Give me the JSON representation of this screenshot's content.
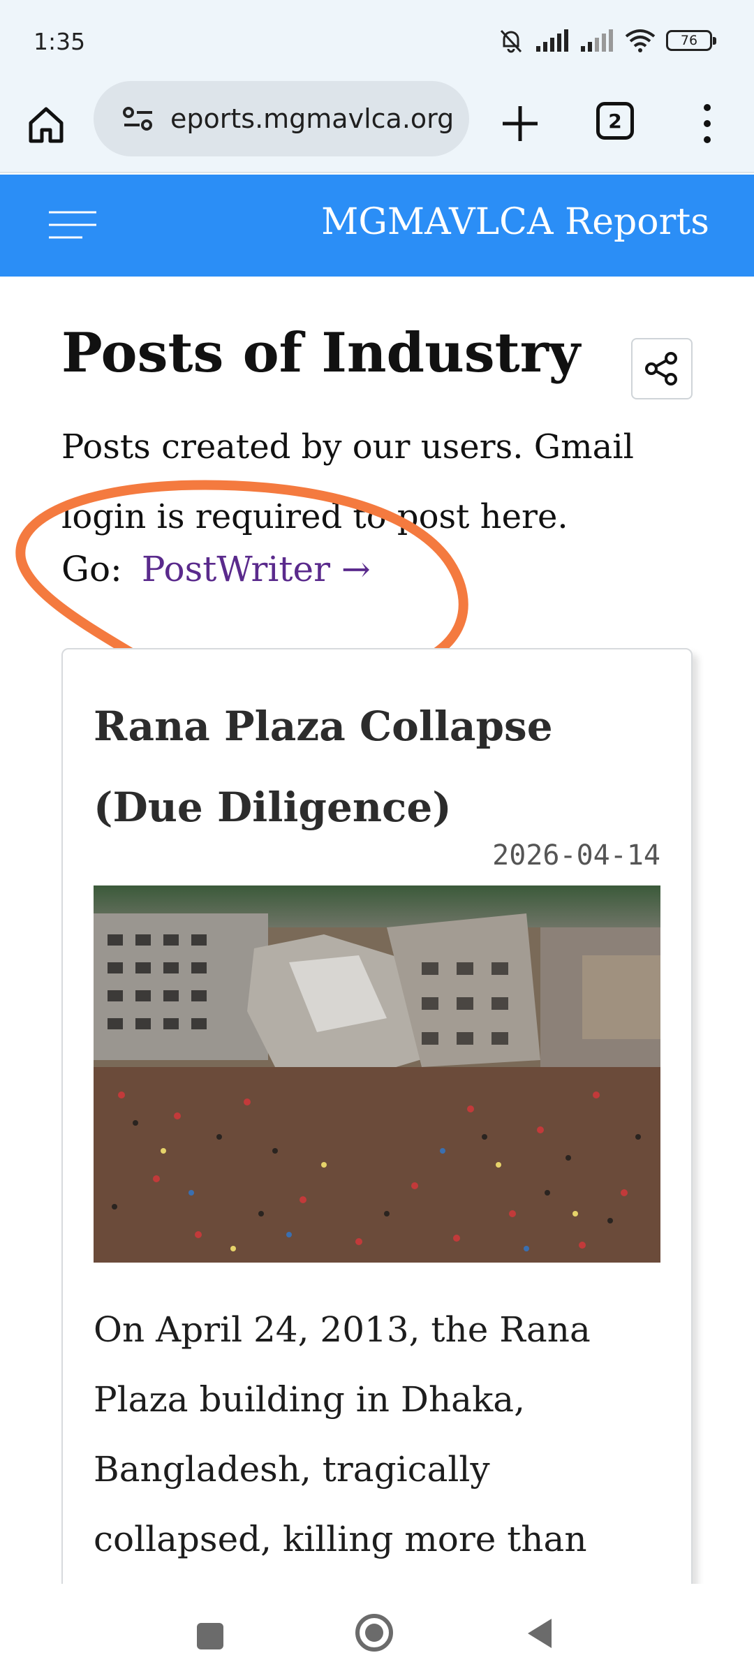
{
  "status_bar": {
    "time": "1:35",
    "battery": "76"
  },
  "browser": {
    "url": "eports.mgmavlca.org",
    "tab_count": "2"
  },
  "site": {
    "title": "MGMAVLCA Reports"
  },
  "page": {
    "heading": "Posts of Industry",
    "description": "Posts created by our users. Gmail login is required to post here.",
    "go_label": "Go:",
    "go_link": "PostWriter →"
  },
  "post": {
    "title": "Rana Plaza Collapse (Due Diligence)",
    "date": "2026-04-14",
    "body": "On April 24, 2013, the Rana Plaza building in Dhaka, Bangladesh, tragically collapsed, killing more than"
  },
  "colors": {
    "header_blue": "#2b8ef6",
    "link_purple": "#5a2a8c",
    "annotation_orange": "#f47a3f"
  },
  "icons": {
    "home": "home-icon",
    "site_settings": "tune-icon",
    "new_tab": "plus-icon",
    "menu": "more-vert-icon",
    "hamburger": "hamburger-menu-icon",
    "share": "share-icon"
  }
}
